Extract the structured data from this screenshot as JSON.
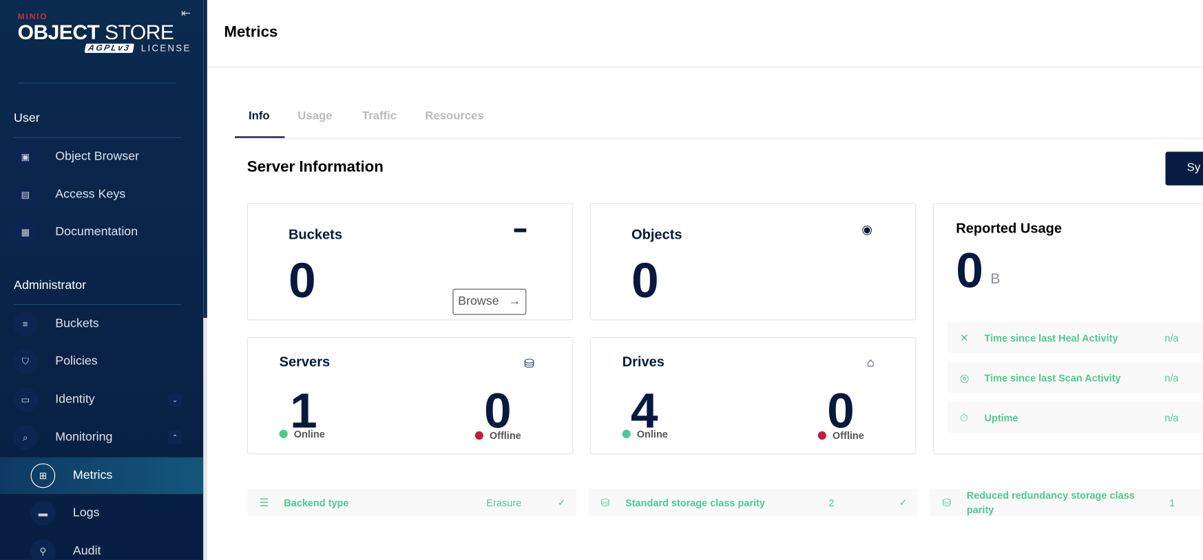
{
  "sidebar": {
    "logo": {
      "brand": "MINIO",
      "product_bold": "OBJECT",
      "product_light": "STORE",
      "license_badge": "AGPLv3",
      "license": "LICENSE"
    },
    "collapse_icon": "⇤",
    "sections": [
      {
        "label": "User"
      },
      {
        "label": "Administrator"
      }
    ],
    "user_items": [
      {
        "label": "Object Browser",
        "icon": "▣"
      },
      {
        "label": "Access Keys",
        "icon": "▤"
      },
      {
        "label": "Documentation",
        "icon": "▦"
      }
    ],
    "admin_items": [
      {
        "label": "Buckets",
        "icon": "≡"
      },
      {
        "label": "Policies",
        "icon": "⛉"
      },
      {
        "label": "Identity",
        "icon": "▭",
        "chevron": "⌄"
      },
      {
        "label": "Monitoring",
        "icon": "⌕",
        "chevron": "⌃"
      }
    ],
    "monitoring_items": [
      {
        "label": "Metrics",
        "icon": "⊞",
        "active": true
      },
      {
        "label": "Logs",
        "icon": "▬"
      },
      {
        "label": "Audit",
        "icon": "⚲"
      }
    ]
  },
  "header": {
    "title": "Metrics"
  },
  "tabs": [
    {
      "label": "Info",
      "active": true
    },
    {
      "label": "Usage"
    },
    {
      "label": "Traffic"
    },
    {
      "label": "Resources"
    }
  ],
  "section_title": "Server Information",
  "sync_button": "Sy",
  "cards": {
    "buckets": {
      "title": "Buckets",
      "value": "0",
      "browse": "Browse",
      "browse_arrow": "→",
      "icon": "▬"
    },
    "objects": {
      "title": "Objects",
      "value": "0",
      "icon": "◉"
    },
    "servers": {
      "title": "Servers",
      "online": "1",
      "offline": "0",
      "online_label": "Online",
      "offline_label": "Offline",
      "icon": "⛁"
    },
    "drives": {
      "title": "Drives",
      "online": "4",
      "offline": "0",
      "online_label": "Online",
      "offline_label": "Offline",
      "icon": "⌂"
    },
    "usage": {
      "title": "Reported Usage",
      "value": "0",
      "unit": "B",
      "rows": [
        {
          "label": "Time since last Heal Activity",
          "value": "n/a",
          "icon": "✕"
        },
        {
          "label": "Time since last Scan Activity",
          "value": "n/a",
          "icon": "◎"
        },
        {
          "label": "Uptime",
          "value": "n/a",
          "icon": "⏱"
        }
      ]
    }
  },
  "info_rows": [
    {
      "label": "Backend type",
      "value": "Erasure",
      "check": "✓",
      "icon": "☰"
    },
    {
      "label": "Standard storage class parity",
      "value": "2",
      "check": "✓",
      "icon": "⛁"
    },
    {
      "label": "Reduced redundancy storage class parity",
      "value": "1",
      "icon": "⛁"
    }
  ],
  "colors": {
    "navy": "#07193e",
    "green": "#4ccb8f",
    "online": "#4ccb8f",
    "offline": "#c51b3f",
    "sidebar": "#0a2a4e"
  }
}
